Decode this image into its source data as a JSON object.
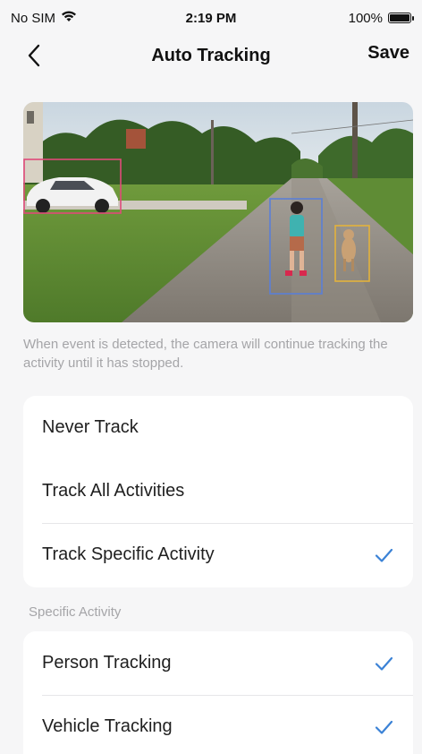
{
  "status_bar": {
    "carrier": "No SIM",
    "time": "2:19 PM",
    "battery": "100%"
  },
  "nav": {
    "title": "Auto Tracking",
    "save_label": "Save",
    "back_icon": "chevron-left-icon"
  },
  "preview": {
    "image_description_icon": "camera-preview-image"
  },
  "description": "When event is detected, the camera will continue tracking the activity until it has stopped.",
  "tracking_options": [
    {
      "label": "Never Track",
      "selected": false
    },
    {
      "label": "Track All Activities",
      "selected": false
    },
    {
      "label": "Track Specific Activity",
      "selected": true
    }
  ],
  "specific_activity": {
    "section_label": "Specific Activity",
    "items": [
      {
        "label": "Person Tracking",
        "selected": true
      },
      {
        "label": "Vehicle Tracking",
        "selected": true
      }
    ]
  },
  "colors": {
    "accent": "#3b82d6",
    "vehicle_box": "#e04a7a",
    "person_box": "#5b7fd6",
    "pet_box": "#e3b23c"
  }
}
